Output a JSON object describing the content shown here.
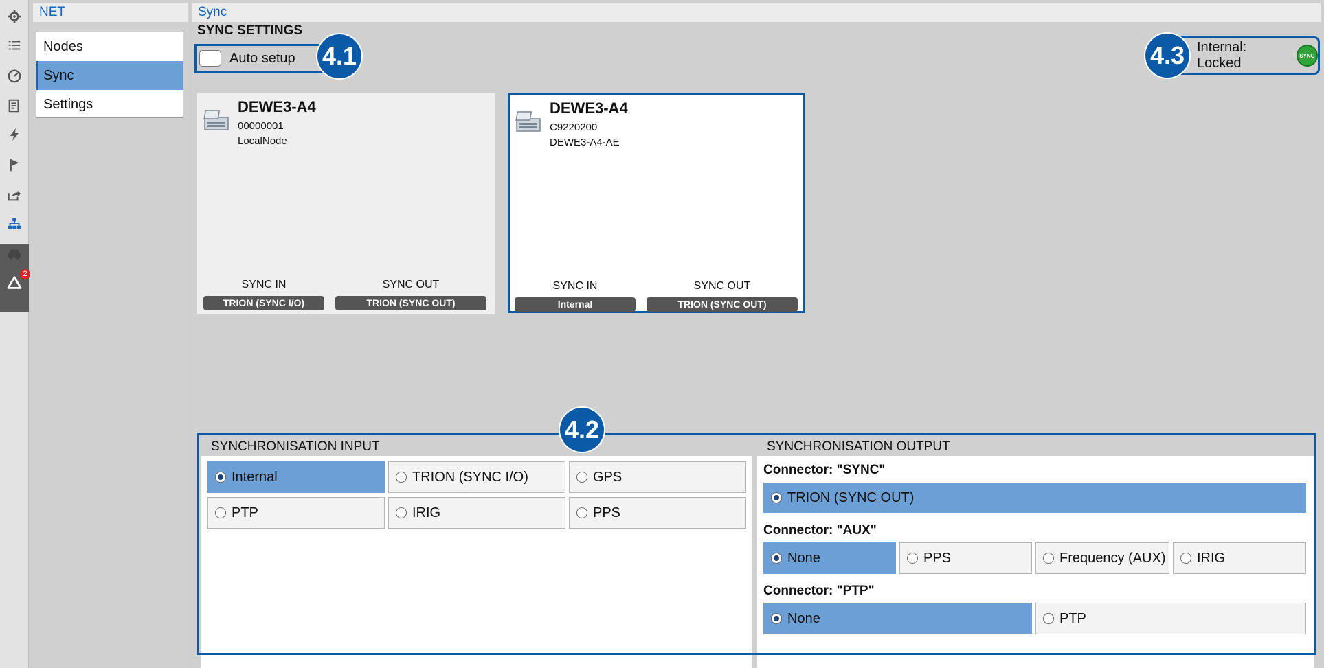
{
  "rail": {
    "icons": [
      "gear-icon",
      "list-icon",
      "gauge-icon",
      "report-icon",
      "lightning-icon",
      "flag-icon",
      "export-icon",
      "network-icon",
      "car-icon",
      "warning-icon"
    ],
    "badge": "2"
  },
  "sidebar": {
    "title": "NET",
    "items": [
      {
        "label": "Nodes"
      },
      {
        "label": "Sync"
      },
      {
        "label": "Settings"
      }
    ]
  },
  "main": {
    "title": "Sync",
    "section_title": "SYNC SETTINGS",
    "auto_setup_label": "Auto setup",
    "status_text": "Internal: Locked",
    "status_icon_text": "SYNC",
    "status_color": "#2ea43a"
  },
  "callouts": {
    "c41": "4.1",
    "c42": "4.2",
    "c43": "4.3"
  },
  "nodes": [
    {
      "name": "DEWE3-A4",
      "serial": "00000001",
      "subtitle": "LocalNode",
      "sync_in_label": "SYNC IN",
      "sync_in": "TRION (SYNC I/O)",
      "sync_out_label": "SYNC OUT",
      "sync_out": "TRION (SYNC OUT)"
    },
    {
      "name": "DEWE3-A4",
      "serial": "C9220200",
      "subtitle": "DEWE3-A4-AE",
      "sync_in_label": "SYNC IN",
      "sync_in": "Internal",
      "sync_out_label": "SYNC OUT",
      "sync_out": "TRION (SYNC OUT)"
    }
  ],
  "sync_input": {
    "title": "SYNCHRONISATION INPUT",
    "options": [
      "Internal",
      "TRION (SYNC I/O)",
      "GPS",
      "PTP",
      "IRIG",
      "PPS"
    ],
    "selected": "Internal"
  },
  "sync_output": {
    "title": "SYNCHRONISATION OUTPUT",
    "sync": {
      "label": "Connector: \"SYNC\"",
      "options": [
        "TRION (SYNC OUT)"
      ],
      "selected": "TRION (SYNC OUT)"
    },
    "aux": {
      "label": "Connector: \"AUX\"",
      "options": [
        "None",
        "PPS",
        "Frequency (AUX)",
        "IRIG"
      ],
      "selected": "None"
    },
    "ptp": {
      "label": "Connector: \"PTP\"",
      "options": [
        "None",
        "PTP"
      ],
      "selected": "None"
    }
  },
  "colors": {
    "accent": "#0a5aa8",
    "selection": "#6b9fd6",
    "link": "#1a63b5"
  }
}
